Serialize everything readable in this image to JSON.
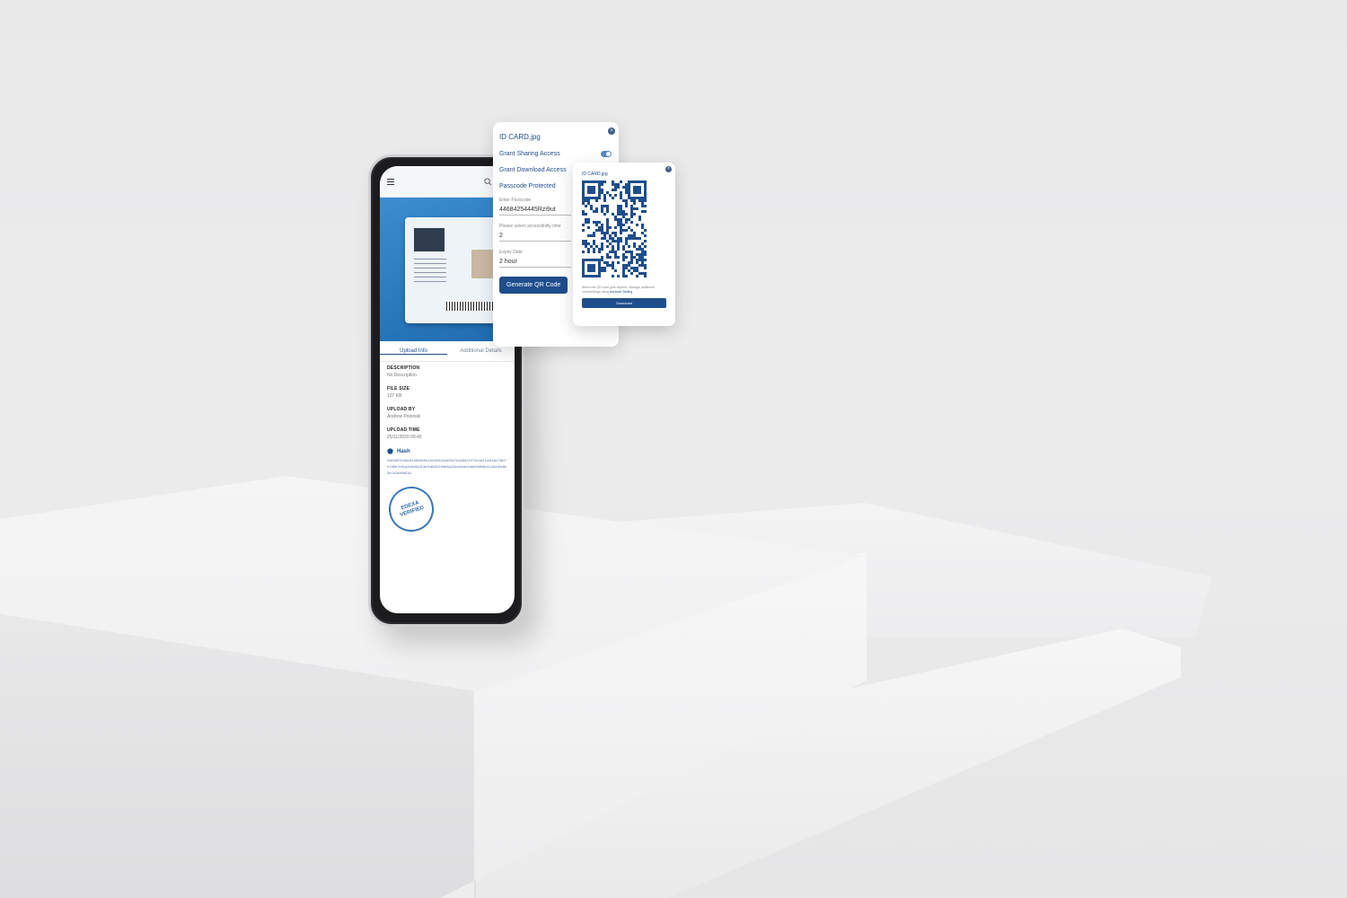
{
  "app": {
    "tabs": [
      "Upload Info",
      "Additional Details"
    ],
    "fields": [
      {
        "label": "DESCRIPTION",
        "value": "No Description"
      },
      {
        "label": "FILE SIZE",
        "value": "107 KB"
      },
      {
        "label": "UPLOAD BY",
        "value": "Andrew Polonski"
      },
      {
        "label": "UPLOAD TIME",
        "value": "25/11/2020 09:45"
      }
    ],
    "hash_label": "Hash",
    "hash_value": "0xf0d5f7e4f4c8146b5b9e11fe0e52a4d90b7e4a5d21970e4e21d4f1ab73fb7e7d5b7e91a2e6c92d13a7b8c531ff9b8a22ec8d4b2f4a0c6ff58c014b2d5e8e3b7a1d90b63d",
    "stamp_text": "EDEXA VERIFIED",
    "accent_color": "#1f4e8c"
  },
  "share_panel": {
    "file_name": "ID CARD.jpg",
    "grant_sharing": "Grant Sharing Access",
    "grant_download": "Grant Download Access",
    "passcode_protected": "Passcode Protected",
    "passcode_label": "Enter Passcode",
    "passcode_value": "44684254445Rzi9ut",
    "accessibility_label": "Please select accessibility time",
    "accessibility_value": "2",
    "expiry_label": "Expiry Date",
    "expiry_value": "2 hour",
    "generate_button": "Generate QR Code",
    "close_glyph": "×"
  },
  "qr_panel": {
    "file_name": "ID CARD.jpg",
    "note": "Below the QR code gets expired. Manage additional rules/settings using",
    "note_link": "Advance Setting",
    "download_button": "Download",
    "close_glyph": "×"
  }
}
